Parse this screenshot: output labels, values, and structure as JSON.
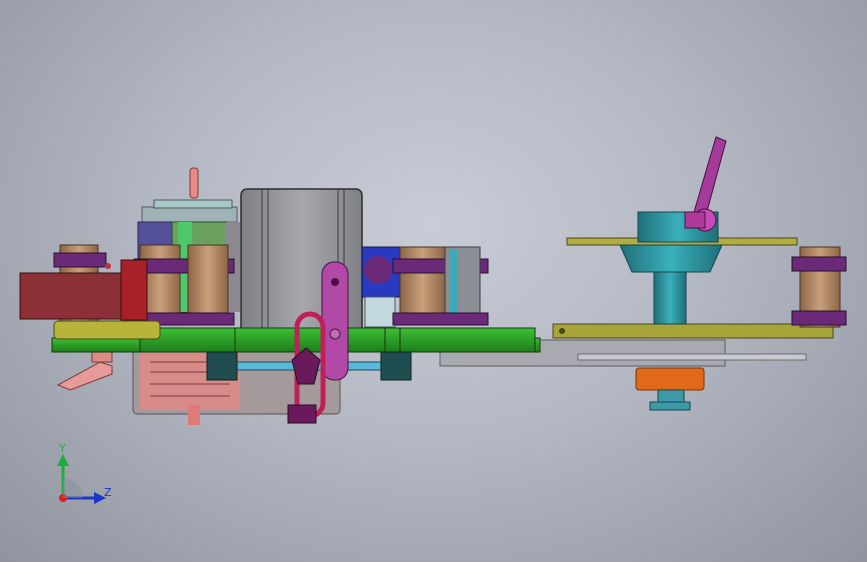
{
  "viewport": {
    "background_top": "#c9ccd6",
    "background_bottom": "#8f949f"
  },
  "triad": {
    "y_label": "Y",
    "z_label": "Z",
    "y_color": "#1fae3a",
    "z_color": "#1e35c8",
    "x_color": "#d42020"
  },
  "colors": {
    "green_plate": "#2fa52a",
    "olive_plate": "#a7a43a",
    "purple": "#6b2a78",
    "tan": "#b88a64",
    "maroon": "#8a3036",
    "gray_box": "#9a9ca2",
    "teal": "#3c9aa6",
    "magenta": "#b03a9a",
    "orange": "#e06a1a",
    "pink": "#e07a78"
  }
}
